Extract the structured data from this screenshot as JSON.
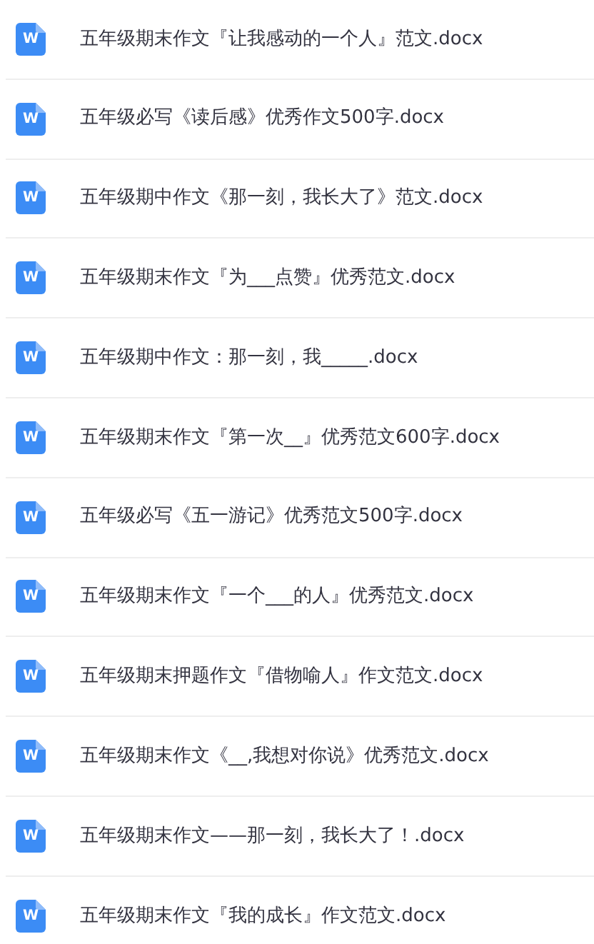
{
  "files": [
    {
      "icon_label": "W",
      "name": "五年级期末作文『让我感动的一个人』范文.docx"
    },
    {
      "icon_label": "W",
      "name": "五年级必写《读后感》优秀作文500字.docx"
    },
    {
      "icon_label": "W",
      "name": "五年级期中作文《那一刻，我长大了》范文.docx"
    },
    {
      "icon_label": "W",
      "name": "五年级期末作文『为___点赞』优秀范文.docx"
    },
    {
      "icon_label": "W",
      "name": "五年级期中作文：那一刻，我_____.docx"
    },
    {
      "icon_label": "W",
      "name": "五年级期末作文『第一次__』优秀范文600字.docx"
    },
    {
      "icon_label": "W",
      "name": "五年级必写《五一游记》优秀范文500字.docx"
    },
    {
      "icon_label": "W",
      "name": "五年级期末作文『一个___的人』优秀范文.docx"
    },
    {
      "icon_label": "W",
      "name": "五年级期末押题作文『借物喻人』作文范文.docx"
    },
    {
      "icon_label": "W",
      "name": "五年级期末作文《__,我想对你说》优秀范文.docx"
    },
    {
      "icon_label": "W",
      "name": "五年级期末作文——那一刻，我长大了！.docx"
    },
    {
      "icon_label": "W",
      "name": "五年级期末作文『我的成长』作文范文.docx"
    }
  ]
}
